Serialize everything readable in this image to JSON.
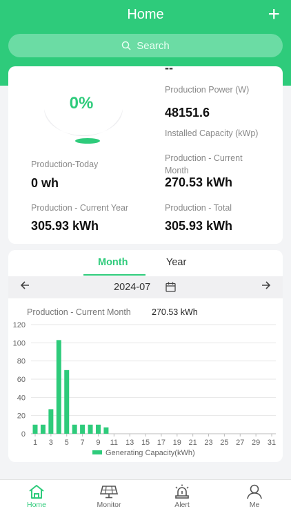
{
  "header": {
    "title": "Home",
    "add_label": "+",
    "search_placeholder": "Search"
  },
  "overview": {
    "percent": "0%",
    "power_value": "--",
    "power_label": "Production Power (W)",
    "capacity_value": "48151.6",
    "capacity_label": "Installed Capacity (kWp)",
    "today_label": "Production-Today",
    "today_value": "0 wh",
    "month_label": "Production - Current Month",
    "month_value": "270.53 kWh",
    "year_label": "Production - Current Year",
    "year_value": "305.93 kWh",
    "total_label": "Production - Total",
    "total_value": "305.93 kWh"
  },
  "tabs": {
    "month": "Month",
    "year": "Year",
    "selected": "Month"
  },
  "date": "2024-07",
  "chart_header": {
    "label": "Production - Current Month",
    "value": "270.53 kWh"
  },
  "chart_data": {
    "type": "bar",
    "x": [
      1,
      2,
      3,
      4,
      5,
      6,
      7,
      8,
      9,
      10,
      11,
      12,
      13,
      14,
      15,
      16,
      17,
      18,
      19,
      20,
      21,
      22,
      23,
      24,
      25,
      26,
      27,
      28,
      29,
      30,
      31
    ],
    "x_ticks": [
      1,
      3,
      5,
      7,
      9,
      11,
      13,
      15,
      17,
      19,
      21,
      23,
      25,
      27,
      29,
      31
    ],
    "values": [
      10,
      10,
      27,
      103,
      70,
      10,
      10,
      10,
      10,
      7,
      0,
      0,
      0,
      0,
      0,
      0,
      0,
      0,
      0,
      0,
      0,
      0,
      0,
      0,
      0,
      0,
      0,
      0,
      0,
      0,
      0
    ],
    "ylim": [
      0,
      120
    ],
    "y_ticks": [
      0,
      20,
      40,
      60,
      80,
      100,
      120
    ],
    "legend": "Generating Capacity(kWh)",
    "color": "#2ecb7b"
  },
  "nav": {
    "home": "Home",
    "monitor": "Monitor",
    "alert": "Alert",
    "me": "Me",
    "active": "Home"
  },
  "colors": {
    "accent": "#2ecb7b"
  }
}
